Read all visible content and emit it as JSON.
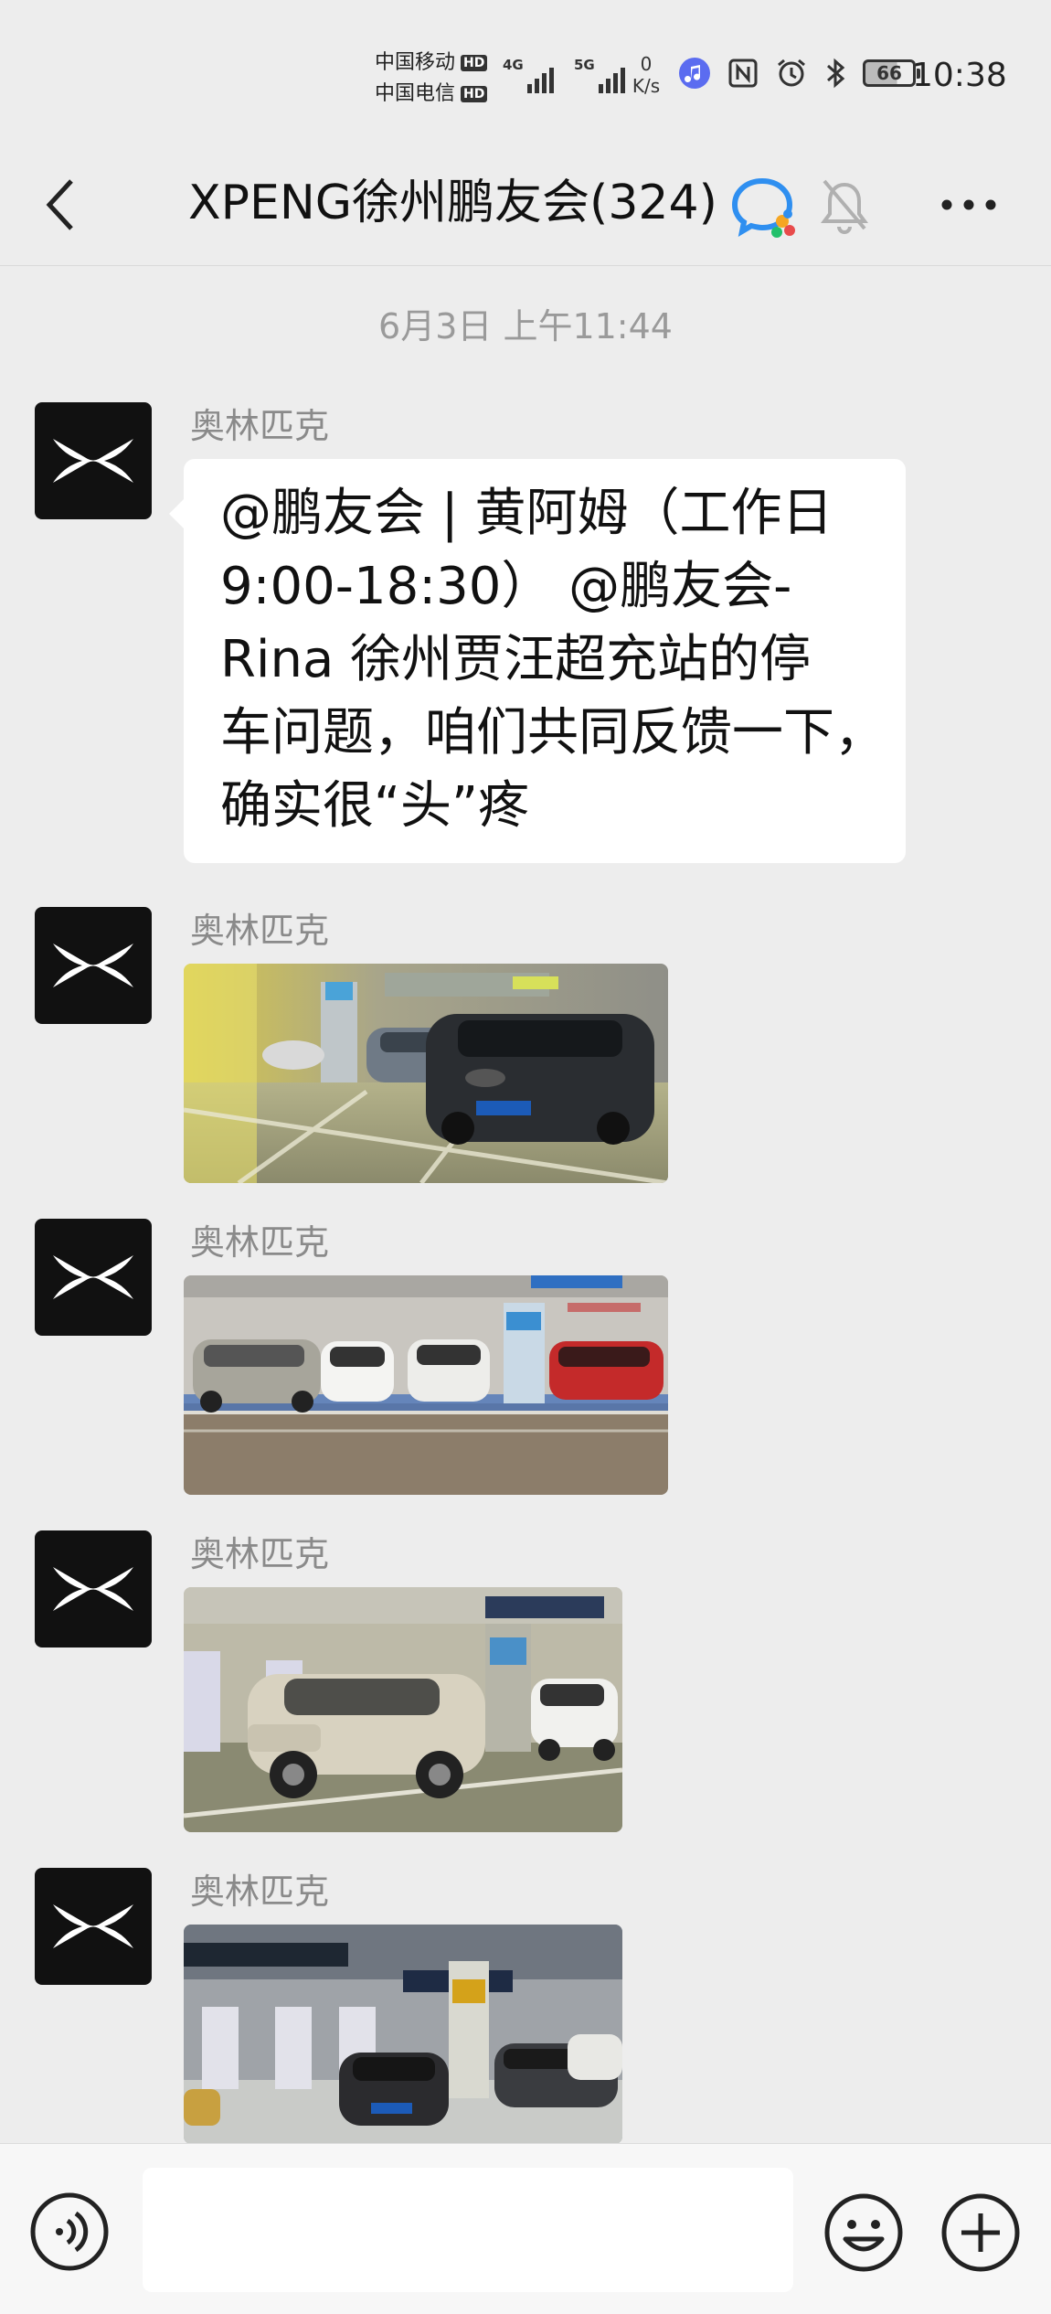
{
  "status_bar": {
    "carrier_1": "中国移动",
    "carrier_2": "中国电信",
    "hd_label": "HD",
    "net_1": "4G",
    "net_2": "5G",
    "speed_value": "0",
    "speed_unit": "K/s",
    "battery_level": "66",
    "time": "10:38",
    "icons": [
      "music-icon",
      "nfc-icon",
      "alarm-icon",
      "bluetooth-icon",
      "battery-icon"
    ]
  },
  "header": {
    "title": "XPENG徐州鹏友会(324)",
    "icons": [
      "back-icon",
      "wecom-icon",
      "mute-bell-icon",
      "more-icon"
    ]
  },
  "chat": {
    "timestamp": "6月3日 上午11:44",
    "messages": [
      {
        "sender": "奥林匹克",
        "type": "text",
        "lines": [
          "@鹏友会 | 黄阿姆（工作日",
          "9:00-18:30） @鹏友会-",
          "Rina  徐州贾汪超充站的停",
          "车问题，咱们共同反馈一下，",
          "确实很“头”疼"
        ]
      },
      {
        "sender": "奥林匹克",
        "type": "image",
        "image": "parking-photo-1"
      },
      {
        "sender": "奥林匹克",
        "type": "image",
        "image": "parking-photo-2"
      },
      {
        "sender": "奥林匹克",
        "type": "image",
        "image": "parking-photo-3"
      },
      {
        "sender": "奥林匹克",
        "type": "image",
        "image": "parking-photo-4"
      }
    ]
  },
  "input_bar": {
    "message_value": "",
    "icons": [
      "voice-icon",
      "emoji-icon",
      "plus-icon"
    ]
  },
  "colors": {
    "background": "#ededed",
    "bubble": "#ffffff",
    "avatar_bg": "#111111",
    "muted_text": "#8a8a8a"
  }
}
